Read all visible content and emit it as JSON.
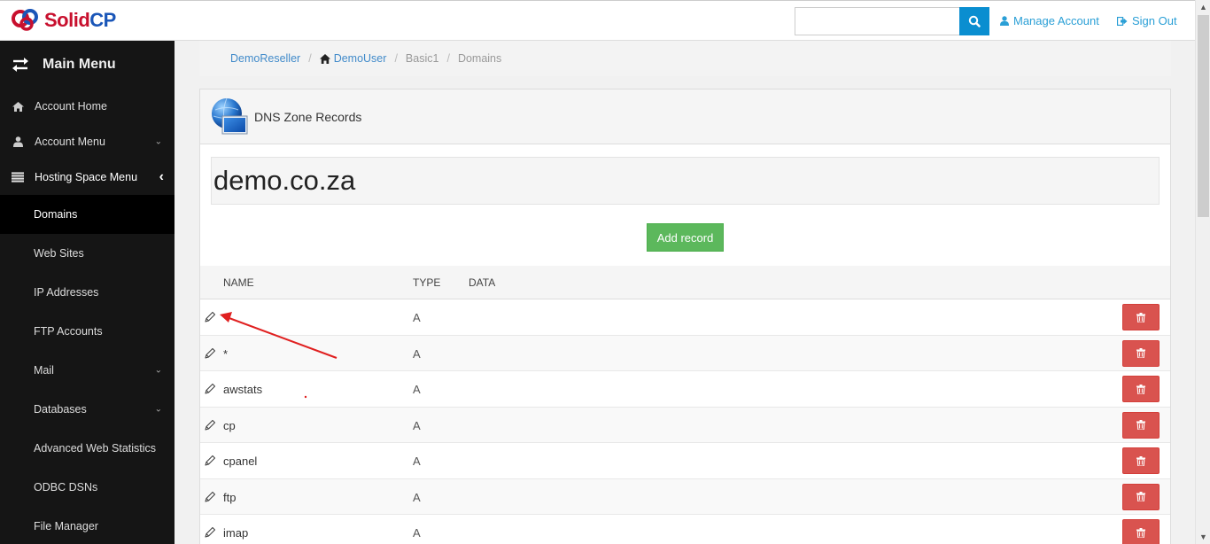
{
  "brand": {
    "part1": "Solid",
    "part2": "CP"
  },
  "topbar": {
    "search_placeholder": "",
    "search_value": "",
    "manage_account": "Manage Account",
    "sign_out": "Sign Out"
  },
  "sidebar": {
    "title": "Main Menu",
    "items": [
      {
        "label": "Account Home",
        "icon": "home-icon"
      },
      {
        "label": "Account Menu",
        "icon": "user-icon",
        "expandable": true
      },
      {
        "label": "Hosting Space Menu",
        "icon": "list-icon",
        "expanded": true
      }
    ],
    "sub_items": [
      {
        "label": "Domains",
        "active": true
      },
      {
        "label": "Web Sites"
      },
      {
        "label": "IP Addresses"
      },
      {
        "label": "FTP Accounts"
      },
      {
        "label": "Mail",
        "expandable": true
      },
      {
        "label": "Databases",
        "expandable": true
      },
      {
        "label": "Advanced Web Statistics"
      },
      {
        "label": "ODBC DSNs"
      },
      {
        "label": "File Manager"
      }
    ]
  },
  "breadcrumb": {
    "items": [
      "DemoReseller",
      "DemoUser",
      "Basic1",
      "Domains"
    ],
    "separator": "/"
  },
  "panel": {
    "title": "DNS Zone Records",
    "domain": "demo.co.za",
    "add_button": "Add record",
    "columns": [
      "NAME",
      "TYPE",
      "DATA"
    ],
    "records": [
      {
        "name": "",
        "type": "A",
        "data": ""
      },
      {
        "name": "*",
        "type": "A",
        "data": ""
      },
      {
        "name": "awstats",
        "type": "A",
        "data": ""
      },
      {
        "name": "cp",
        "type": "A",
        "data": ""
      },
      {
        "name": "cpanel",
        "type": "A",
        "data": ""
      },
      {
        "name": "ftp",
        "type": "A",
        "data": ""
      },
      {
        "name": "imap",
        "type": "A",
        "data": ""
      }
    ]
  },
  "colors": {
    "primary": "#0a8ed0",
    "link": "#2a9fd6",
    "success": "#5cb85c",
    "danger": "#d9534f",
    "sidebar_bg": "#151515",
    "annotation": "#e02020"
  }
}
